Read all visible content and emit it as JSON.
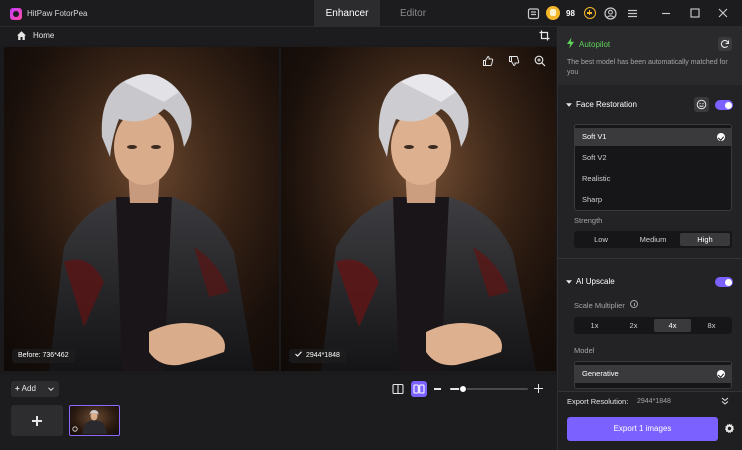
{
  "app": {
    "title": "HitPaw FotorPea"
  },
  "tabs": [
    {
      "label": "Enhancer"
    },
    {
      "label": "Editor"
    }
  ],
  "titlebar": {
    "credits": "98"
  },
  "breadcrumb": {
    "home": "Home"
  },
  "compare": {
    "before_label": "Before: 736*462",
    "after_label": "2944*1848"
  },
  "bottombar": {
    "add_label": "Add",
    "zoom_fraction": 0.17
  },
  "panel": {
    "autopilot": {
      "title": "Autopilot",
      "description": "The best model has been automatically matched for you"
    },
    "face_restoration": {
      "title": "Face Restoration",
      "enabled": true,
      "models": [
        "Soft V1",
        "Soft V2",
        "Realistic",
        "Sharp"
      ],
      "selected_model": "Soft V1",
      "strength_label": "Strength",
      "strength_options": [
        "Low",
        "Medium",
        "High"
      ],
      "selected_strength": "High"
    },
    "ai_upscale": {
      "title": "AI Upscale",
      "enabled": true,
      "scale_label": "Scale Multiplier",
      "scale_options": [
        "1x",
        "2x",
        "4x",
        "8x"
      ],
      "selected_scale": "4x",
      "model_label": "Model",
      "model_options": [
        "Generative"
      ],
      "selected_model": "Generative"
    },
    "export": {
      "resolution_label": "Export Resolution:",
      "resolution_value": "2944*1848",
      "button_label": "Export 1 images"
    }
  },
  "colors": {
    "accent": "#7b61ff",
    "autopilot_green": "#5fd35a",
    "credit_gold": "#f5b72a"
  }
}
